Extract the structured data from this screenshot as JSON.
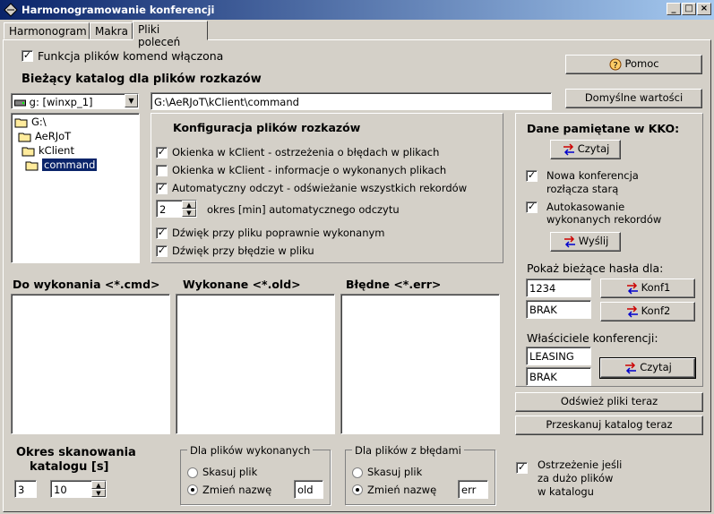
{
  "window": {
    "title": "Harmonogramowanie konferencji",
    "min": "_",
    "max": "□",
    "close": "×"
  },
  "tabs": [
    "Harmonogram",
    "Makra",
    "Pliki poleceń"
  ],
  "top": {
    "enable_label": "Funkcja plików komend włączona",
    "enable_checked": true,
    "help_button": "Pomoc",
    "defaults_button": "Domyślne wartości",
    "current_dir_label": "Bieżący katalog dla plików rozkazów",
    "drive": "g: [winxp_1]",
    "path": "G:\\AeRJoT\\kClient\\command"
  },
  "tree": [
    "G:\\",
    "AeRJoT",
    "kClient",
    "command"
  ],
  "config": {
    "title": "Konfiguracja plików rozkazów",
    "opt1": "Okienka w kClient - ostrzeżenia o błędach w plikach",
    "opt2": "Okienka w kClient - informacje o wykonanych plikach",
    "opt3": "Automatyczny odczyt - odświeżanie wszystkich rekordów",
    "interval_value": "2",
    "interval_label": "okres [min] automatycznego odczytu",
    "opt4": "Dźwięk przy pliku poprawnie wykonanym",
    "opt5": "Dźwięk przy błędzie w pliku",
    "checks": [
      true,
      false,
      true,
      true,
      true
    ]
  },
  "kko": {
    "title": "Dane pamiętane w KKO:",
    "read_button": "Czytaj",
    "new_conf": "Nowa konferencja rozłącza starą",
    "new_conf_l1": "Nowa konferencja",
    "new_conf_l2": "rozłącza starą",
    "autodel_l1": "Autokasowanie",
    "autodel_l2": "wykonanych rekordów",
    "send_button": "Wyślij",
    "show_pw": "Pokaż bieżące hasła dla:",
    "pw1": "1234",
    "pw2": "BRAK",
    "konf1": "Konf1",
    "konf2": "Konf2",
    "owners": "Właściciele konferencji:",
    "owner1": "LEASING",
    "owner2": "BRAK",
    "owner_read": "Czytaj"
  },
  "lists": {
    "todo": "Do wykonania <*.cmd>",
    "done": "Wykonane <*.old>",
    "err": "Błędne <*.err>"
  },
  "actions": {
    "refresh": "Odśwież pliki teraz",
    "rescan": "Przeskanuj katalog teraz"
  },
  "scan": {
    "label_l1": "Okres skanowania",
    "label_l2": "katalogu [s]",
    "v1": "3",
    "v2": "10"
  },
  "done_group": {
    "title": "Dla plików wykonanych",
    "delete": "Skasuj plik",
    "rename": "Zmień nazwę",
    "ext": "old"
  },
  "err_group": {
    "title": "Dla plików z błędami",
    "delete": "Skasuj plik",
    "rename": "Zmień nazwę",
    "ext": "err"
  },
  "warn": {
    "l1": "Ostrzeżenie jeśli",
    "l2": "za dużo plików",
    "l3": "w katalogu",
    "checked": true
  },
  "colors": {
    "titlebar": "#0a246a",
    "face": "#d4d0c8",
    "selection": "#0a246a"
  }
}
